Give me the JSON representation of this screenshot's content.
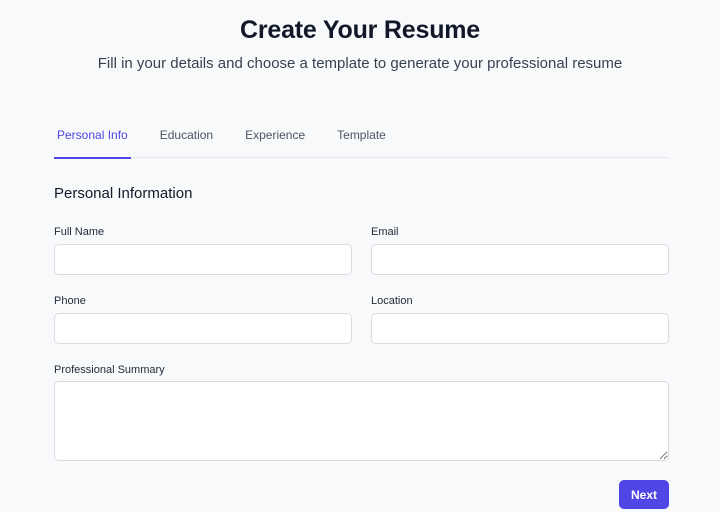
{
  "header": {
    "title": "Create Your Resume",
    "subtitle": "Fill in your details and choose a template to generate your professional resume"
  },
  "tabs": [
    {
      "label": "Personal Info",
      "active": true
    },
    {
      "label": "Education",
      "active": false
    },
    {
      "label": "Experience",
      "active": false
    },
    {
      "label": "Template",
      "active": false
    }
  ],
  "form": {
    "section_title": "Personal Information",
    "full_name": {
      "label": "Full Name",
      "value": ""
    },
    "email": {
      "label": "Email",
      "value": ""
    },
    "phone": {
      "label": "Phone",
      "value": ""
    },
    "location": {
      "label": "Location",
      "value": ""
    },
    "summary": {
      "label": "Professional Summary",
      "value": ""
    },
    "next_label": "Next"
  },
  "colors": {
    "accent": "#4f46e5",
    "background": "#f8f9fb"
  }
}
